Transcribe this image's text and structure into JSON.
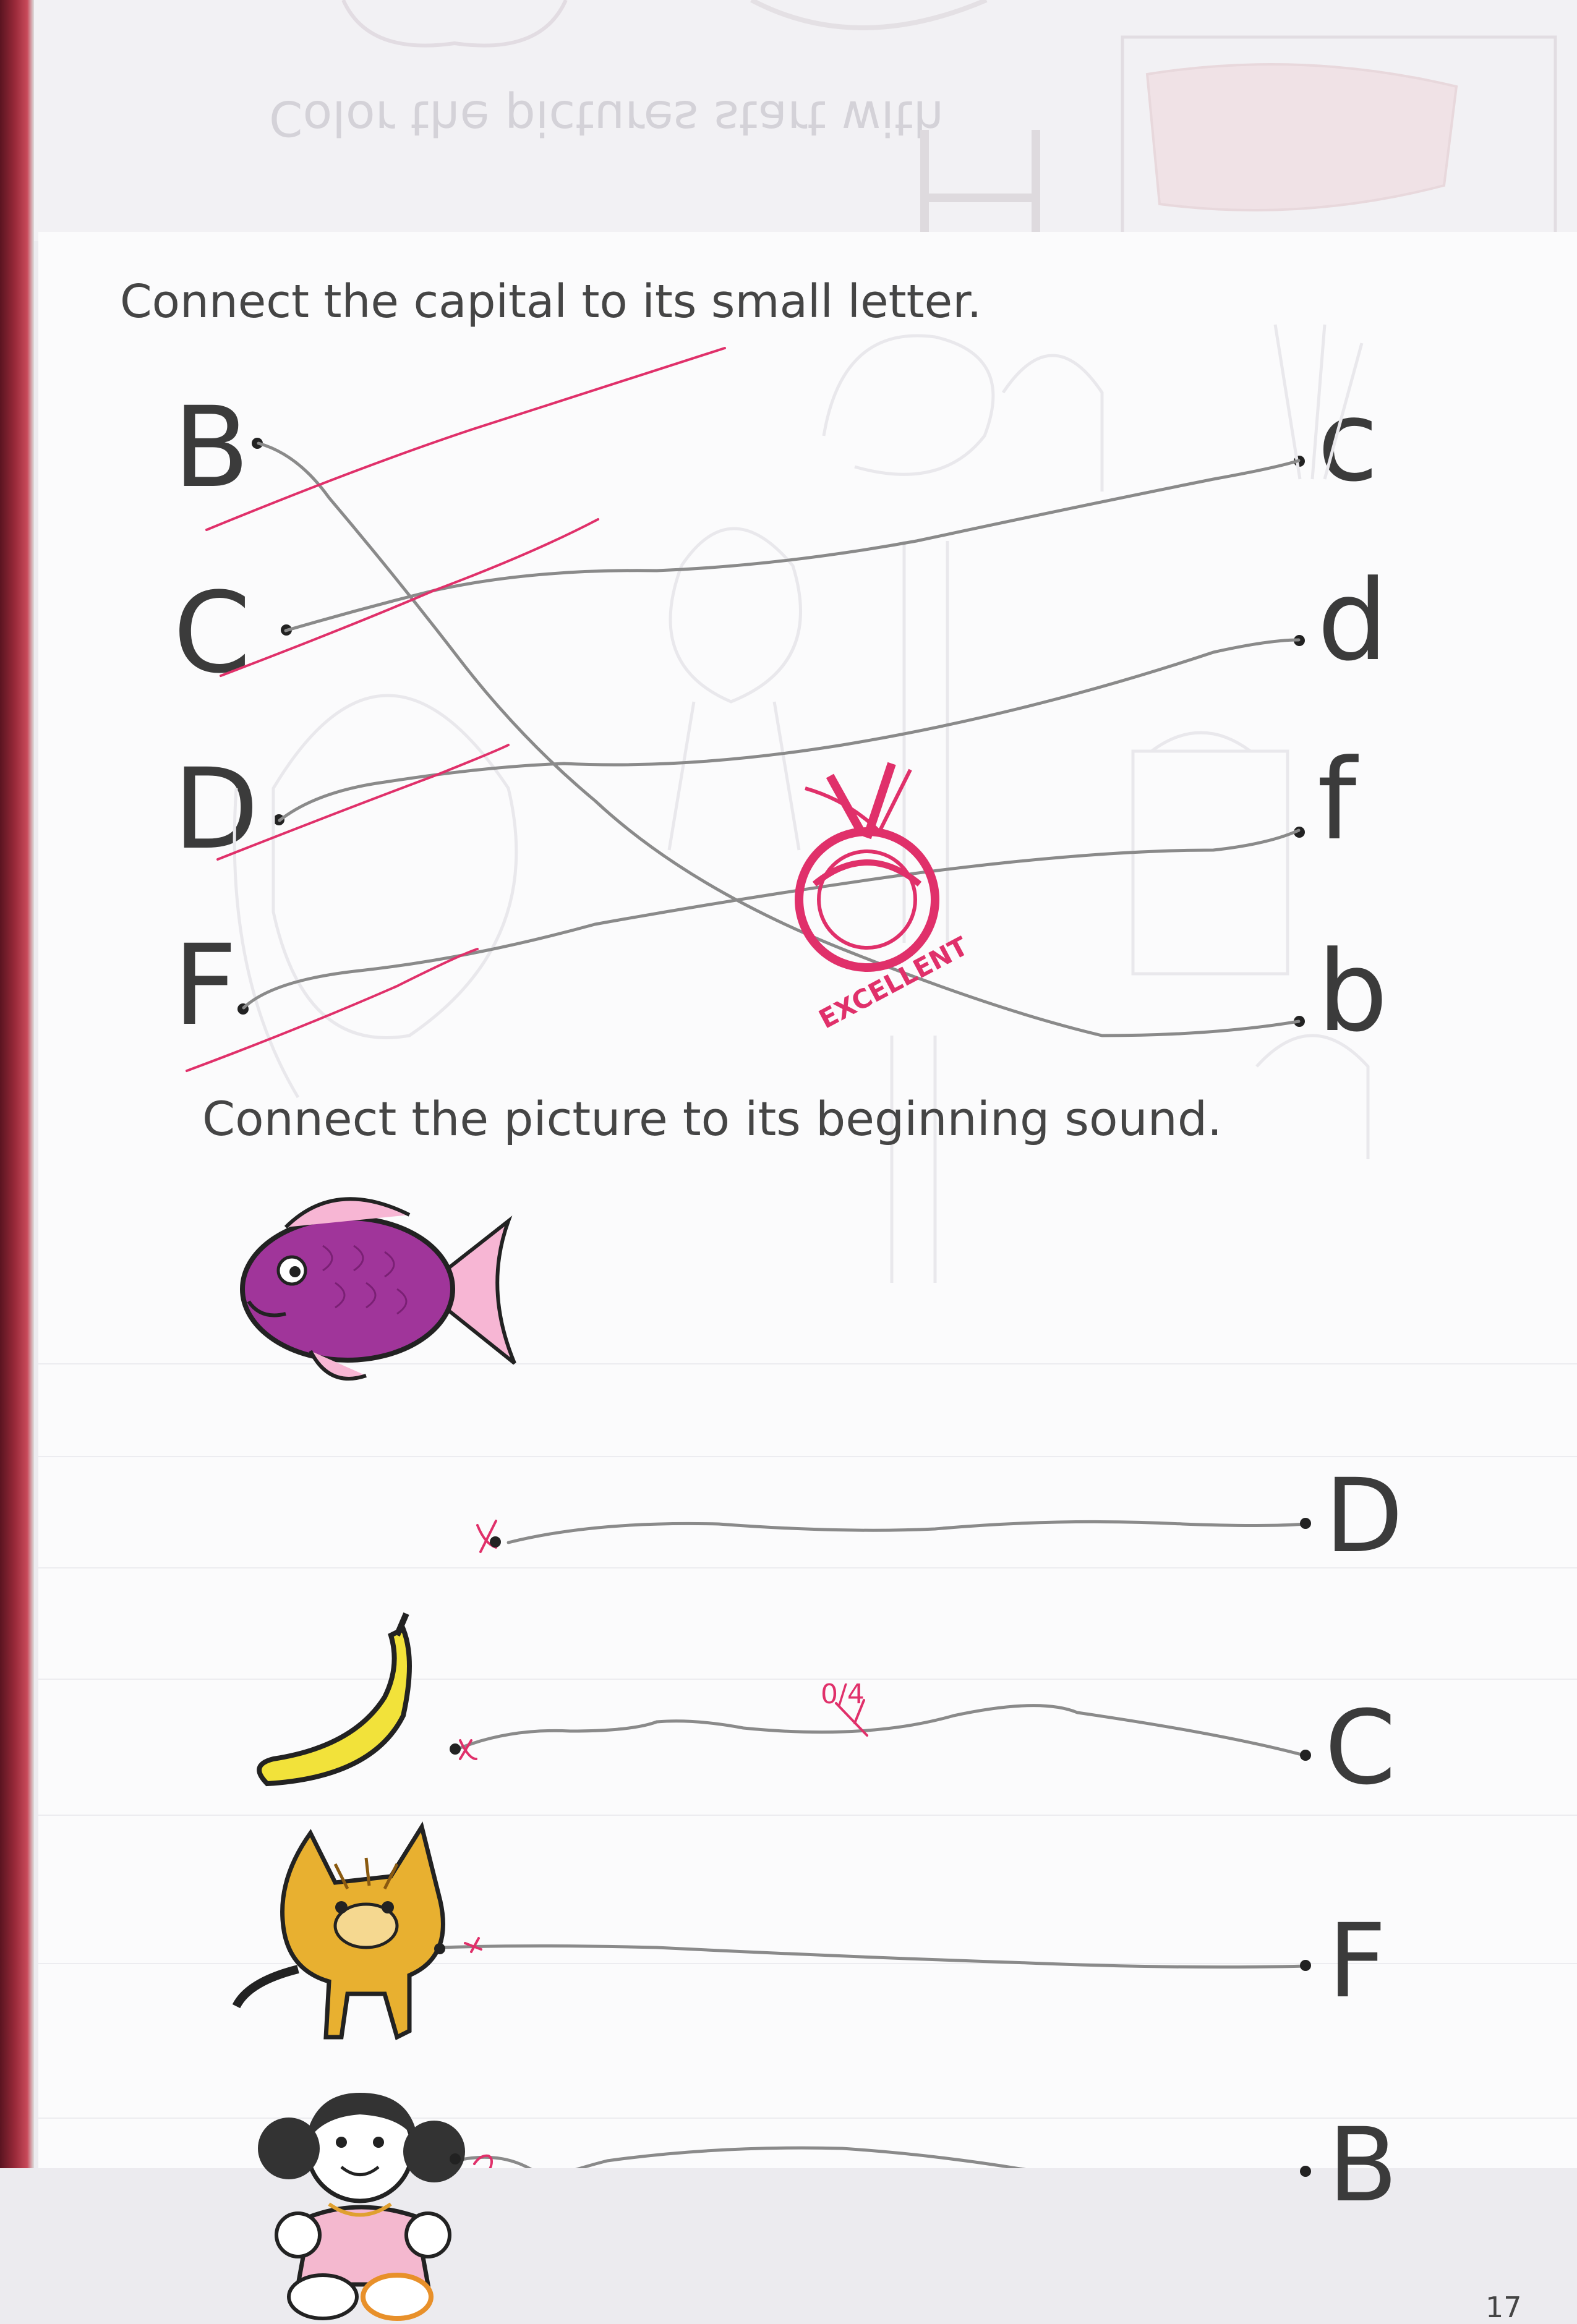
{
  "previous_page": {
    "mirrored_title": "Color the pictures start with"
  },
  "exercise_1": {
    "instruction": "Connect the capital to its small letter.",
    "capitals": [
      "B",
      "C",
      "D",
      "F"
    ],
    "small_letters": [
      "c",
      "d",
      "f",
      "b"
    ],
    "connections": [
      {
        "from": "B",
        "to": "b"
      },
      {
        "from": "C",
        "to": "c"
      },
      {
        "from": "D",
        "to": "d"
      },
      {
        "from": "F",
        "to": "f"
      }
    ]
  },
  "stamp": {
    "text": "EXCELLENT",
    "color": "#e0306a"
  },
  "exercise_2": {
    "instruction": "Connect the picture to its beginning sound.",
    "pictures": [
      "fish-icon",
      "banana-icon",
      "cat-icon",
      "doll-icon"
    ],
    "sound_letters": [
      "D",
      "C",
      "F",
      "B"
    ],
    "score_mark": "0/4"
  },
  "page_number": "17",
  "colors": {
    "pencil": "#8a8a8a",
    "teacher_pen": "#e0306a",
    "fish": "#a0359a",
    "banana": "#f2e23a",
    "cat": "#e8b030",
    "doll_dress": "#f4b8cf"
  }
}
